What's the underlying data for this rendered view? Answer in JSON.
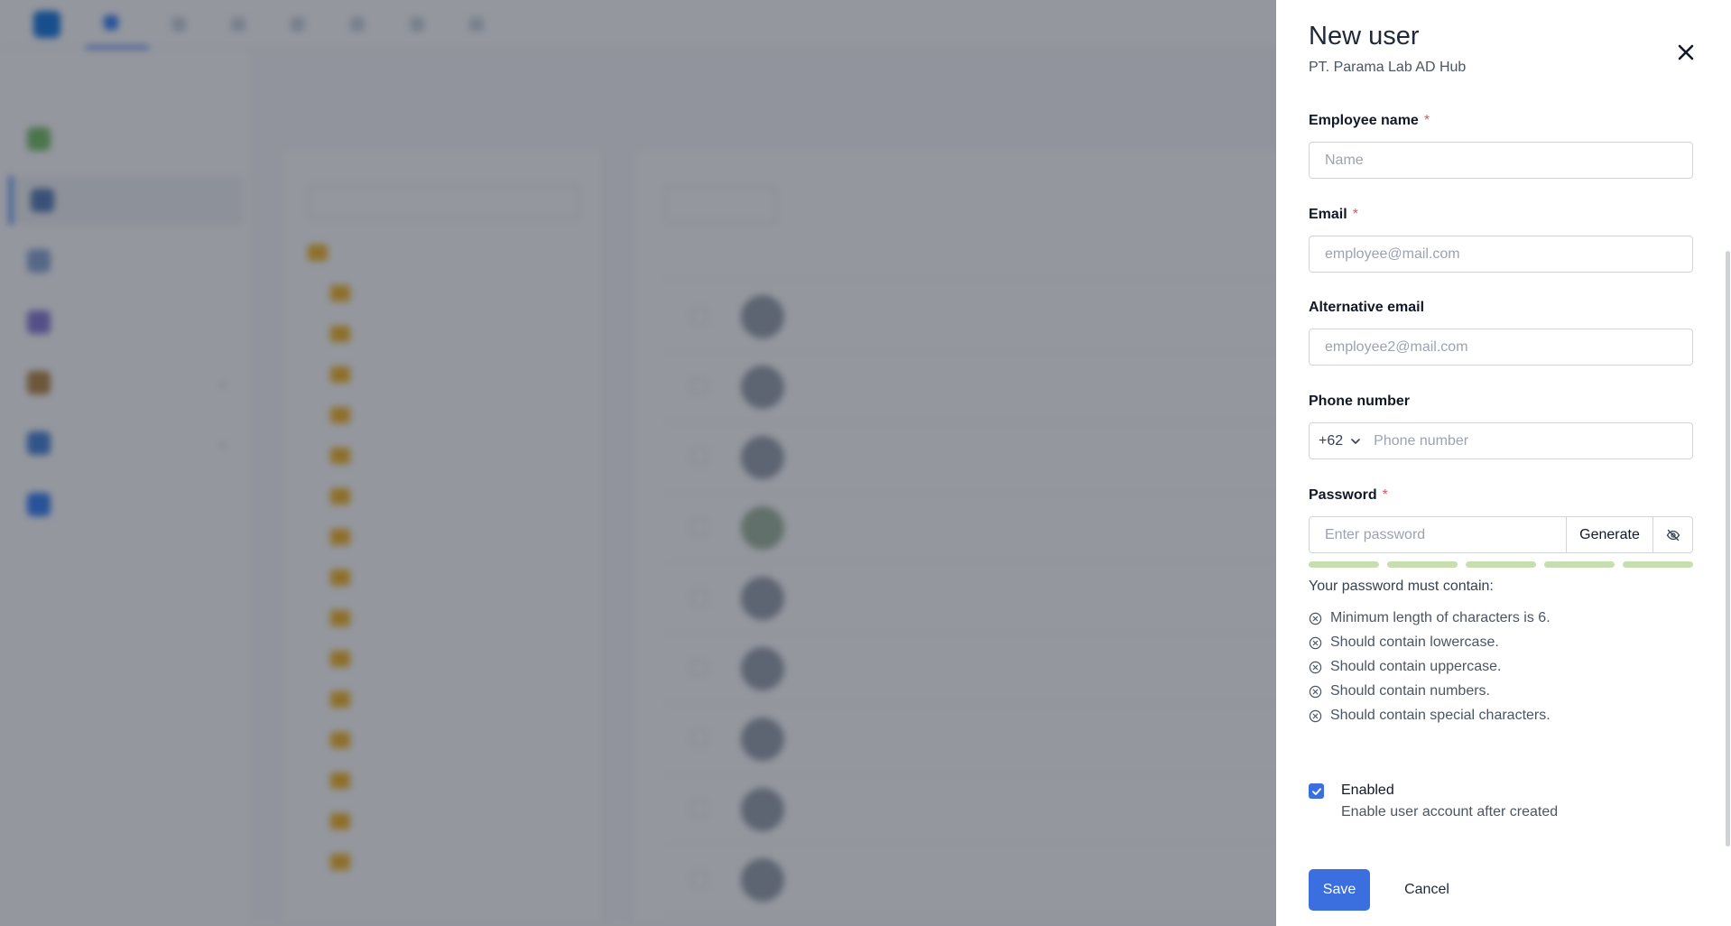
{
  "drawer": {
    "title": "New user",
    "subtitle": "PT. Parama Lab AD Hub",
    "fields": {
      "employee_name": {
        "label": "Employee name",
        "required_mark": "*",
        "placeholder": "Name",
        "value": ""
      },
      "email": {
        "label": "Email",
        "required_mark": "*",
        "placeholder": "employee@mail.com",
        "value": ""
      },
      "alt_email": {
        "label": "Alternative email",
        "placeholder": "employee2@mail.com",
        "value": ""
      },
      "phone": {
        "label": "Phone number",
        "country_code": "+62",
        "placeholder": "Phone number",
        "value": ""
      },
      "password": {
        "label": "Password",
        "required_mark": "*",
        "placeholder": "Enter password",
        "value": "",
        "generate_label": "Generate",
        "strength_segments": 5
      }
    },
    "password_rules": {
      "title": "Your password must contain:",
      "items": [
        "Minimum length of characters is 6.",
        "Should contain lowercase.",
        "Should contain uppercase.",
        "Should contain numbers.",
        "Should contain special characters."
      ]
    },
    "enabled": {
      "checked": true,
      "label": "Enabled",
      "description": "Enable user account after created"
    },
    "actions": {
      "save": "Save",
      "cancel": "Cancel"
    }
  },
  "colors": {
    "primary": "#3b6fe0",
    "required": "#e25555",
    "strength_bar": "#c7dfb0",
    "overlay": "rgba(17,24,39,0.45)"
  },
  "icons": {
    "close": "close-icon",
    "password_visibility": "eye-off-icon",
    "rule_status": "x-circle-icon",
    "country_dropdown": "chevron-down-icon",
    "checkbox": "check-icon"
  }
}
